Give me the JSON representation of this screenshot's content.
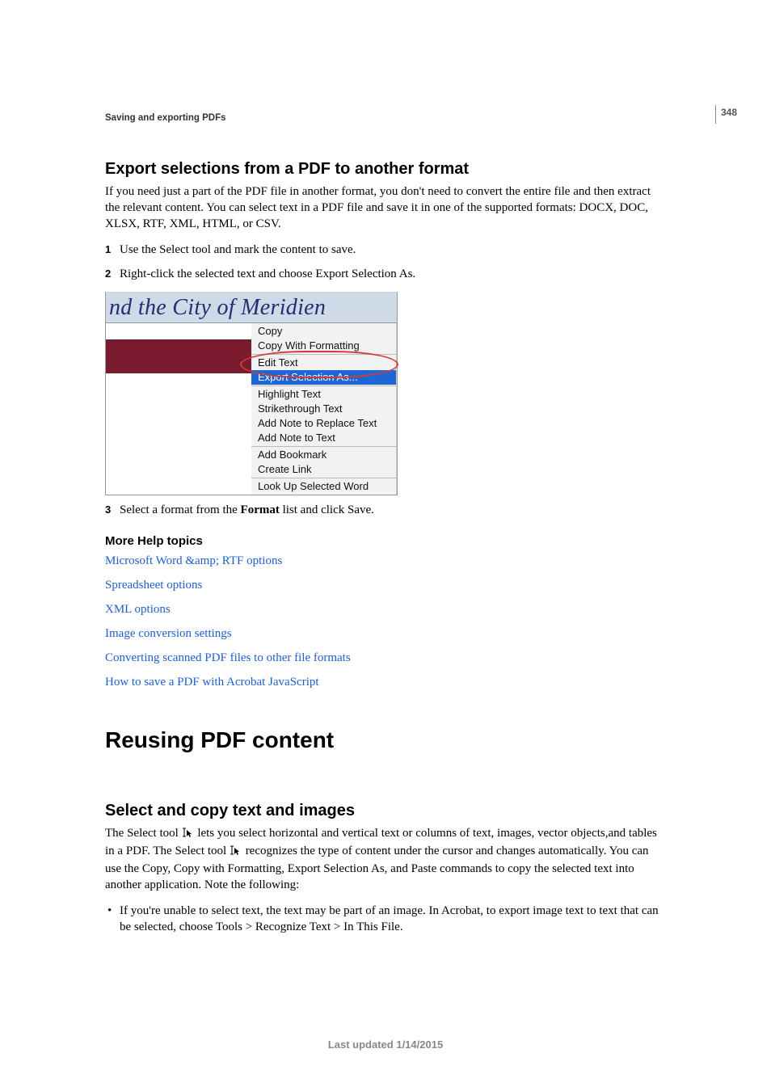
{
  "page_number": "348",
  "running_head": "Saving and exporting PDFs",
  "section1": {
    "title": "Export selections from a PDF to another format",
    "para": "If you need just a part of the PDF file in another format, you don't need to convert the entire file and then extract the relevant content. You can select text in a PDF file and save it in one of the supported formats: DOCX, DOC, XLSX, RTF, XML, HTML, or CSV.",
    "steps": {
      "s1": "Use the Select tool and mark the content to save.",
      "s2": "Right-click the selected text and choose Export Selection As.",
      "s3_a": "Select a format from the ",
      "s3_b": "Format",
      "s3_c": " list and click Save."
    }
  },
  "figure": {
    "sel_text": "nd the City of Meridien",
    "menu": {
      "copy": "Copy",
      "copy_fmt": "Copy With Formatting",
      "edit_text": "Edit Text",
      "export_sel": "Export Selection As...",
      "highlight": "Highlight Text",
      "strike": "Strikethrough Text",
      "note_replace": "Add Note to Replace Text",
      "note_text": "Add Note to Text",
      "bookmark": "Add Bookmark",
      "link": "Create Link",
      "lookup": "Look Up Selected Word"
    }
  },
  "more_help": {
    "title": "More Help topics",
    "l1": "Microsoft Word &amp; RTF options",
    "l2": "Spreadsheet options",
    "l3": "XML options",
    "l4": "Image conversion settings",
    "l5": "Converting scanned PDF files to other file formats",
    "l6": "How to save a PDF with Acrobat JavaScript"
  },
  "chapter": "Reusing PDF content",
  "section2": {
    "title": "Select and copy text and images",
    "para_a": "The Select tool ",
    "para_b": " lets you select horizontal and vertical text or columns of text, images, vector objects,and tables in a PDF. The Select tool ",
    "para_c": " recognizes the type of content under the cursor and changes automatically. You can use the Copy, Copy with Formatting, Export Selection As, and Paste commands to copy the selected text into another application. Note the following:",
    "bullet1": "If you're unable to select text, the text may be part of an image. In Acrobat, to export image text to text that can be selected, choose Tools > Recognize Text > In This File."
  },
  "footer": "Last updated 1/14/2015"
}
